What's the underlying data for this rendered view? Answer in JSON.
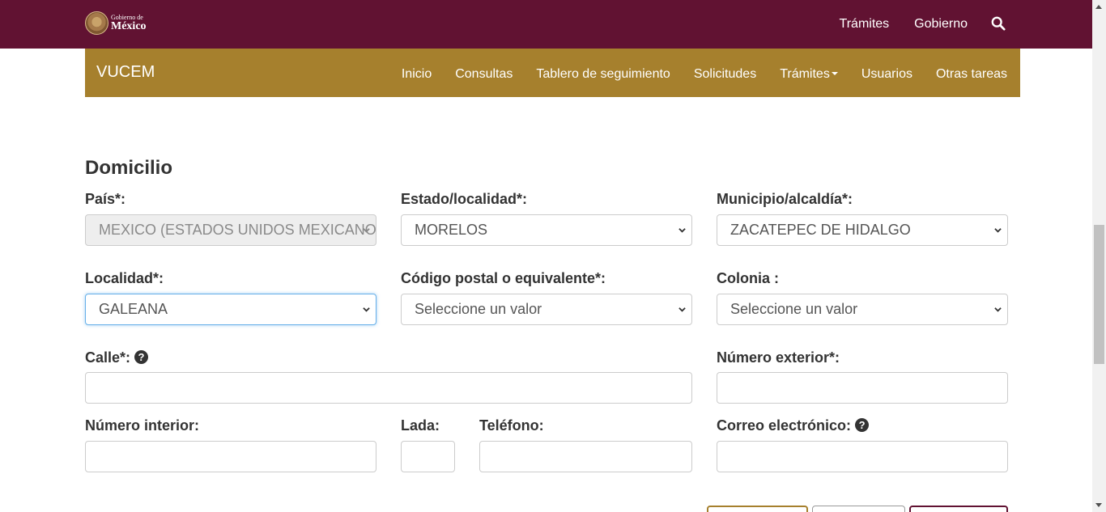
{
  "gov_header": {
    "logo_small": "Gobierno de",
    "logo_big": "México",
    "links": [
      "Trámites",
      "Gobierno"
    ],
    "search_icon": "search-icon",
    "background_color": "#611232"
  },
  "vucem_nav": {
    "brand": "VUCEM",
    "items": [
      "Inicio",
      "Consultas",
      "Tablero de seguimiento",
      "Solicitudes",
      "Trámites",
      "Usuarios",
      "Otras tareas"
    ],
    "background_color": "#a6802d"
  },
  "section": {
    "title": "Domicilio"
  },
  "form": {
    "pais": {
      "label": "País*:",
      "value": "MEXICO (ESTADOS UNIDOS MEXICANOS)"
    },
    "estado": {
      "label": "Estado/localidad*:",
      "value": "MORELOS"
    },
    "municipio": {
      "label": "Municipio/alcaldía*:",
      "value": "ZACATEPEC DE HIDALGO"
    },
    "localidad": {
      "label": "Localidad*:",
      "value": "GALEANA"
    },
    "codigo_postal": {
      "label": "Código postal o equivalente*:",
      "value": "Seleccione un valor"
    },
    "colonia": {
      "label": "Colonia :",
      "value": "Seleccione un valor"
    },
    "calle": {
      "label": "Calle*:",
      "value": ""
    },
    "numero_exterior": {
      "label": "Número exterior*:",
      "value": ""
    },
    "numero_interior": {
      "label": "Número interior:",
      "value": ""
    },
    "lada": {
      "label": "Lada:",
      "value": ""
    },
    "telefono": {
      "label": "Teléfono:",
      "value": ""
    },
    "correo": {
      "label": "Correo electrónico:",
      "value": ""
    },
    "help_glyph": "?"
  }
}
